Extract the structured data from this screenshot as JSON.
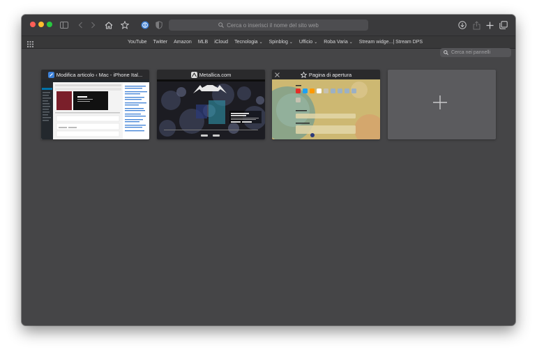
{
  "toolbar": {
    "address_placeholder": "Cerca o inserisci il nome del sito web"
  },
  "favorites": [
    {
      "label": "YouTube",
      "menu": false
    },
    {
      "label": "Twitter",
      "menu": false
    },
    {
      "label": "Amazon",
      "menu": false
    },
    {
      "label": "MLB",
      "menu": false
    },
    {
      "label": "iCloud",
      "menu": false
    },
    {
      "label": "Tecnologia",
      "menu": true
    },
    {
      "label": "Spinblog",
      "menu": true
    },
    {
      "label": "Ufficio",
      "menu": true
    },
    {
      "label": "Roba Varia",
      "menu": true
    },
    {
      "label": "Stream widge...| Stream DPS",
      "menu": false
    }
  ],
  "tab_search": {
    "placeholder": "Cerca nei pannelli"
  },
  "tabs": [
    {
      "title": "Modifica articolo ‹ Mac - iPhone Ital...",
      "favicon": "blue-square-icon",
      "favicon_color": "#3b7fd6"
    },
    {
      "title": "Metallica.com",
      "favicon": "metallica-logo-icon",
      "favicon_color": "#dcdcdc"
    },
    {
      "title": "Pagina di apertura",
      "favicon": "star-icon",
      "closable": true
    }
  ],
  "new_tab": {
    "icon": "plus-icon"
  },
  "colors": {
    "window_bg": "#454547",
    "titlebar_bg": "#3a3a3c",
    "card_header_bg": "#2a2a2c",
    "accent_blue": "#3b7fd6"
  }
}
